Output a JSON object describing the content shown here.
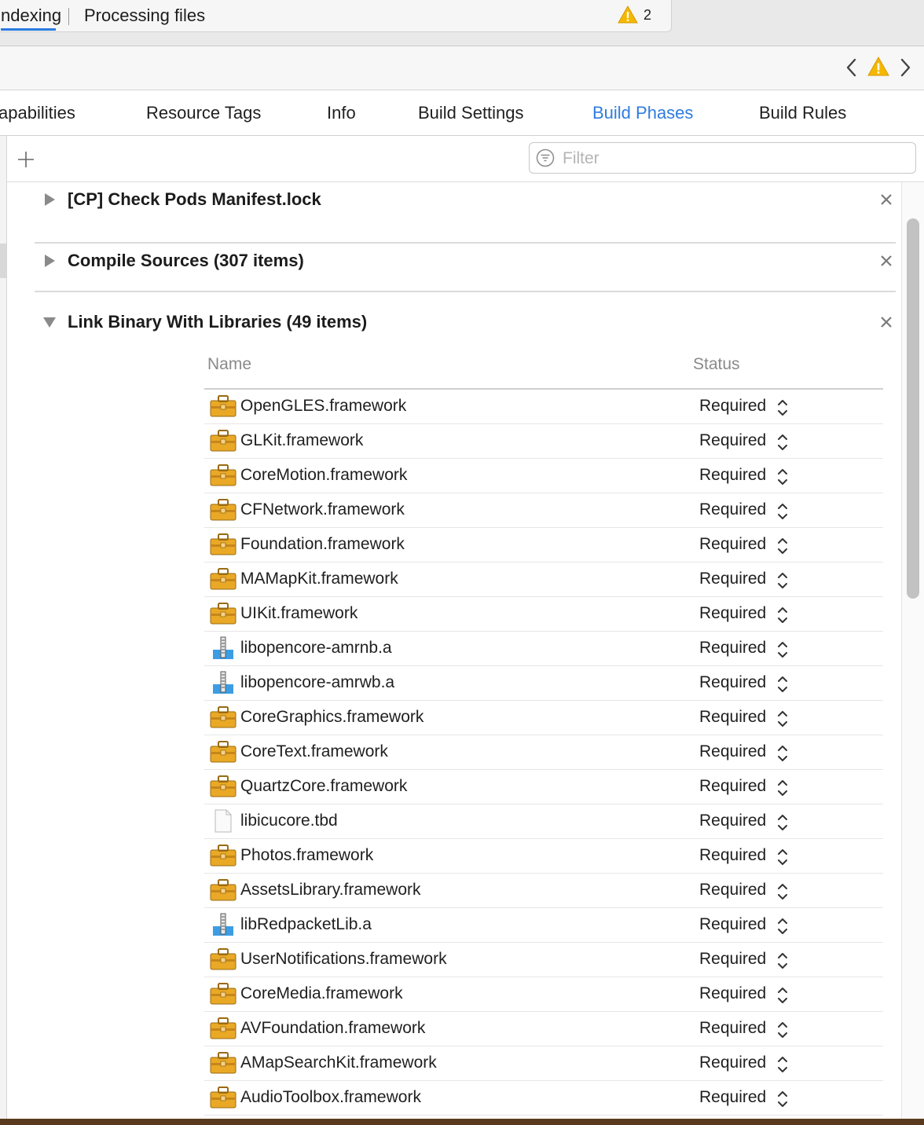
{
  "activity": {
    "indexing": "ndexing",
    "processing": "Processing files",
    "warning_count": "2"
  },
  "tabs": [
    {
      "label": "apabilities"
    },
    {
      "label": "Resource Tags"
    },
    {
      "label": "Info"
    },
    {
      "label": "Build Settings"
    },
    {
      "label": "Build Phases",
      "active": true
    },
    {
      "label": "Build Rules"
    }
  ],
  "filter": {
    "placeholder": "Filter"
  },
  "phases": [
    {
      "title": "[CP] Check Pods Manifest.lock",
      "expanded": false
    },
    {
      "title": "Compile Sources (307 items)",
      "expanded": false
    },
    {
      "title": "Link Binary With Libraries (49 items)",
      "expanded": true
    }
  ],
  "library_table": {
    "headers": {
      "name": "Name",
      "status": "Status"
    },
    "rows": [
      {
        "name": "OpenGLES.framework",
        "icon": "framework-icon",
        "status": "Required"
      },
      {
        "name": "GLKit.framework",
        "icon": "framework-icon",
        "status": "Required"
      },
      {
        "name": "CoreMotion.framework",
        "icon": "framework-icon",
        "status": "Required"
      },
      {
        "name": "CFNetwork.framework",
        "icon": "framework-icon",
        "status": "Required"
      },
      {
        "name": "Foundation.framework",
        "icon": "framework-icon",
        "status": "Required"
      },
      {
        "name": "MAMapKit.framework",
        "icon": "framework-icon",
        "status": "Required"
      },
      {
        "name": "UIKit.framework",
        "icon": "framework-icon",
        "status": "Required"
      },
      {
        "name": "libopencore-amrnb.a",
        "icon": "static-library-icon",
        "status": "Required"
      },
      {
        "name": "libopencore-amrwb.a",
        "icon": "static-library-icon",
        "status": "Required"
      },
      {
        "name": "CoreGraphics.framework",
        "icon": "framework-icon",
        "status": "Required"
      },
      {
        "name": "CoreText.framework",
        "icon": "framework-icon",
        "status": "Required"
      },
      {
        "name": "QuartzCore.framework",
        "icon": "framework-icon",
        "status": "Required"
      },
      {
        "name": "libicucore.tbd",
        "icon": "document-icon",
        "status": "Required"
      },
      {
        "name": "Photos.framework",
        "icon": "framework-icon",
        "status": "Required"
      },
      {
        "name": "AssetsLibrary.framework",
        "icon": "framework-icon",
        "status": "Required"
      },
      {
        "name": "libRedpacketLib.a",
        "icon": "static-library-icon",
        "status": "Required"
      },
      {
        "name": "UserNotifications.framework",
        "icon": "framework-icon",
        "status": "Required"
      },
      {
        "name": "CoreMedia.framework",
        "icon": "framework-icon",
        "status": "Required"
      },
      {
        "name": "AVFoundation.framework",
        "icon": "framework-icon",
        "status": "Required"
      },
      {
        "name": "AMapSearchKit.framework",
        "icon": "framework-icon",
        "status": "Required"
      },
      {
        "name": "AudioToolbox.framework",
        "icon": "framework-icon",
        "status": "Required"
      }
    ]
  },
  "colors": {
    "accent": "#2f7ce0",
    "warning": "#f5b800",
    "framework_toolbox": "#e9a926"
  }
}
